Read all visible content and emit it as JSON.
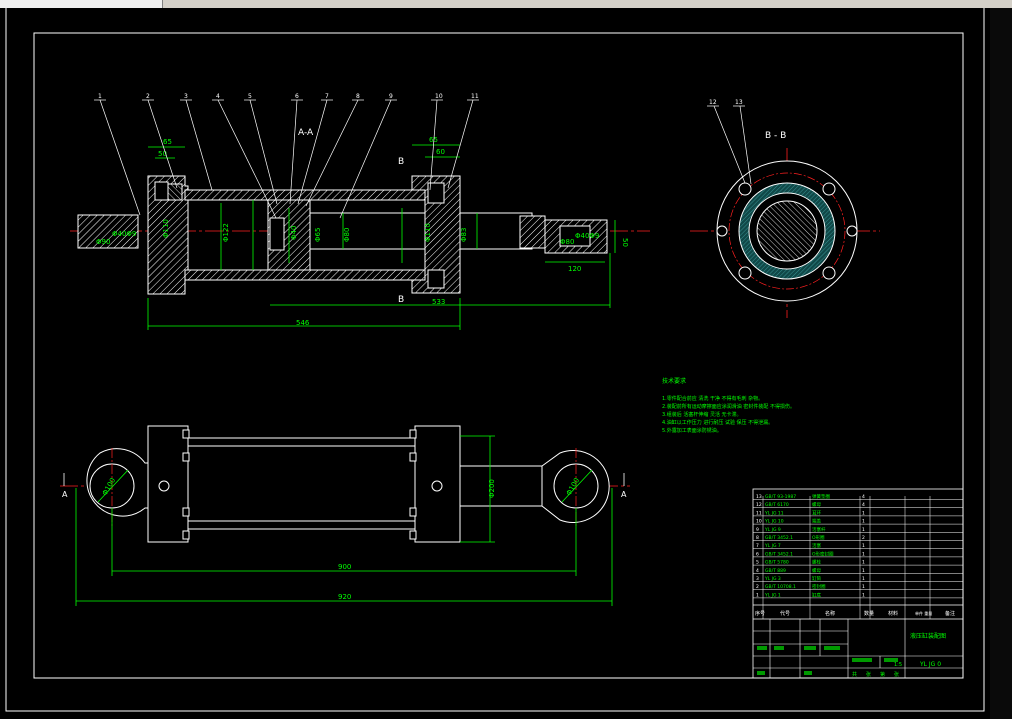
{
  "colors": {
    "background": "#000000",
    "outline": "#ffffff",
    "dimension": "#00ff00",
    "centerline": "#ff2020",
    "leader": "#ffffff",
    "title_text": "#00ff00"
  },
  "icons": [
    "window-pane-icon"
  ],
  "views": {
    "section_aa": {
      "title": "A-A",
      "cut_label": "B",
      "dims": {
        "d65a": "65",
        "d50": "50",
        "d65b": "65",
        "d60": "60",
        "d90": "Φ90",
        "d40h9": "Φ40Φ9",
        "d110a": "Φ110",
        "d122": "Φ122",
        "d40": "Φ40",
        "d65c": "Φ65",
        "d80": "Φ80",
        "d110b": "Φ110",
        "d83": "Φ83",
        "d80r": "Φ80",
        "d40h9r": "Φ40Φ9",
        "d50r": "50",
        "d120": "120",
        "d533": "533",
        "d546": "546"
      },
      "balloons": [
        "1",
        "2",
        "3",
        "4",
        "5",
        "6",
        "7",
        "8",
        "9",
        "10",
        "11"
      ]
    },
    "section_bb": {
      "title": "B - B",
      "balloons": [
        "12",
        "13"
      ]
    },
    "front_view": {
      "cut_left": "A",
      "cut_right": "A",
      "dims": {
        "left_eye": "Φ100",
        "right_eye": "Φ100",
        "height": "Φ200",
        "d900": "900",
        "d920": "920"
      }
    }
  },
  "notes": {
    "title": "技术要求",
    "items": [
      "1.零件配合前应 清洗 干净 不得有毛刺 杂物。",
      "2.装配前所有运动摩擦面应涂润滑油 密封件装配 不得损伤。",
      "3.组装后 活塞杆伸缩 灵活 无卡滞。",
      "4.油缸以工作压力 进行耐压 试验 保压 不得泄漏。",
      "5.外露加工表面涂防锈油。"
    ]
  },
  "bom": {
    "rows": [
      {
        "no": "13",
        "code": "GB/T 93-1987",
        "name": "弹簧垫圈",
        "qty": "4"
      },
      {
        "no": "12",
        "code": "GB/T 6170",
        "name": "螺母",
        "qty": "4"
      },
      {
        "no": "11",
        "code": "YL JG 11",
        "name": "耳环",
        "qty": "1"
      },
      {
        "no": "10",
        "code": "YL JG 10",
        "name": "端盖",
        "qty": "1"
      },
      {
        "no": "9",
        "code": "YL JG 9",
        "name": "活塞杆",
        "qty": "1"
      },
      {
        "no": "8",
        "code": "GB/T 3452.1",
        "name": "O形圈",
        "qty": "2"
      },
      {
        "no": "7",
        "code": "YL JG 7",
        "name": "活塞",
        "qty": "1"
      },
      {
        "no": "6",
        "code": "GB/T 3452.1",
        "name": "O形密封圈",
        "qty": "1"
      },
      {
        "no": "5",
        "code": "GB/T 5780",
        "name": "螺栓",
        "qty": "1"
      },
      {
        "no": "4",
        "code": "GB/T 889",
        "name": "螺母",
        "qty": "1"
      },
      {
        "no": "3",
        "code": "YL JG 3",
        "name": "缸筒",
        "qty": "1"
      },
      {
        "no": "2",
        "code": "GB/T 10708.1",
        "name": "密封圈",
        "qty": "1"
      },
      {
        "no": "1",
        "code": "YL JG 1",
        "name": "缸底",
        "qty": "1"
      }
    ],
    "headers": [
      "序号",
      "代号",
      "名称",
      "数量",
      "材料",
      "单件 重量",
      "备注"
    ],
    "drawing_title": "液压缸装配图",
    "drawing_number": "YL JG 0",
    "scale": "1:5",
    "footer": [
      "共",
      "张",
      "第",
      "张"
    ]
  }
}
